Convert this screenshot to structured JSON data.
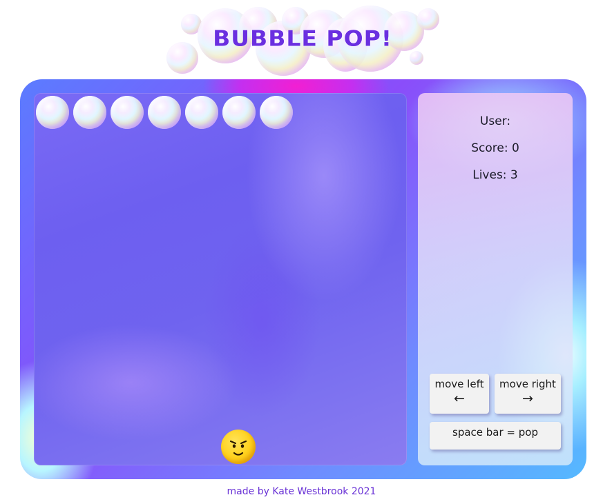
{
  "game": {
    "title": "BUBBLE POP!",
    "bubble_count": 7,
    "player_icon": "angry-face-icon"
  },
  "panel": {
    "user_label": "User:",
    "score_label": "Score: 0",
    "lives_label": "Lives: 3"
  },
  "controls": {
    "move_left_label": "move left",
    "move_left_arrow": "←",
    "move_right_label": "move right",
    "move_right_arrow": "→",
    "pop_label": "space bar = pop"
  },
  "footer": {
    "credit": "made by Kate Westbrook 2021"
  },
  "colors": {
    "title": "#6a2fe0",
    "footer": "#6a33d6",
    "frame_primary": "#8a4dfa",
    "panel_bg": "#e6d8f8"
  }
}
